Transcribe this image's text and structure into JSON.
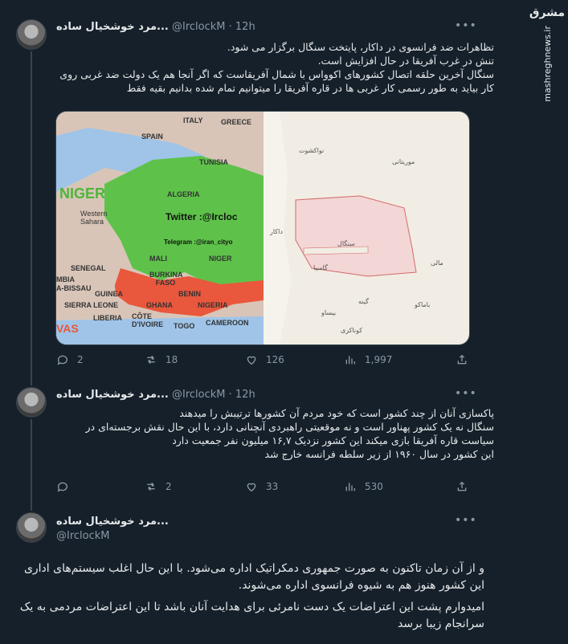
{
  "watermark": {
    "logo": "مشرق",
    "site": "mashreghnews.ir"
  },
  "tweets": [
    {
      "name": "مرد خوشخیال ساده...",
      "handle": "@IrclockM",
      "time": "12h",
      "lines": [
        "تظاهرات ضد فرانسوی در داکار، پایتخت سنگال برگزار می شود.",
        "تنش در غرب آفریقا در حال افزایش است.",
        "سنگال آخرین حلقه اتصال کشورهای اکوواس با شمال آفریقاست که اگر آنجا هم یک دولت ضد غربی روی",
        "کار بیاید به طور رسمی کار غربی ها در قاره آفریقا را میتوانیم تمام شده بدانیم بقیه فقط"
      ],
      "stats": {
        "replies": "2",
        "retweets": "18",
        "likes": "126",
        "views": "1,997"
      },
      "media": {
        "left_labels": [
          "SPAIN",
          "GREECE",
          "ITALY",
          "TUNISIA",
          "ALGERIA",
          "NIGER",
          "Twitter :@Ircloc",
          "Telegram :@iran_cityo",
          "MALI",
          "NIGER",
          "SENEGAL",
          "GUINEA",
          "BURKINA FASO",
          "BENIN",
          "GHANA",
          "NIGERIA",
          "SIERRA LEONE",
          "LIBERIA",
          "CÔTE D'IVOIRE",
          "TOGO",
          "CAMEROON",
          "Western Sahara",
          "MBIA",
          "A-BISSAU",
          "VAS"
        ],
        "right_labels": [
          "نواکشوت",
          "موریتانی",
          "سنگال",
          "داکار",
          "گامبیا",
          "مالی",
          "باماکو",
          "بیساو",
          "گینه",
          "کوناکری"
        ]
      }
    },
    {
      "name": "مرد خوشخیال ساده...",
      "handle": "@IrclockM",
      "time": "12h",
      "lines": [
        "پاکسازی آنان از چند کشور است که خود مردم آن کشورها ترتیبش را میدهند",
        "سنگال نه یک کشور پهناور است و نه موقعیتی راهبردی آنچنانی دارد، با این حال نقش برجسته‌ای در",
        "سیاست قاره آفریقا بازی میکند این کشور نزدیک ۱۶,۷ میلیون نفر جمعیت دارد",
        "این کشور در سال ۱۹۶۰ از زیر سلطه فرانسه خارج شد"
      ],
      "stats": {
        "replies": "",
        "retweets": "2",
        "likes": "33",
        "views": "530"
      }
    },
    {
      "name": "مرد خوشخیال ساده...",
      "handle": "@IrclockM",
      "lines": [
        "و از آن زمان تاکنون به صورت جمهوری دمکراتیک اداره می‌شود. با این حال اغلب سیستم‌های اداری",
        "این کشور هنوز هم به شیوه فرانسوی اداره می‌شوند.",
        "",
        "امیدوارم پشت این اعتراضات یک دست نامرئی برای هدایت آنان باشد تا این اعتراضات مردمی به یک",
        "سرانجام زیبا برسد"
      ]
    }
  ]
}
